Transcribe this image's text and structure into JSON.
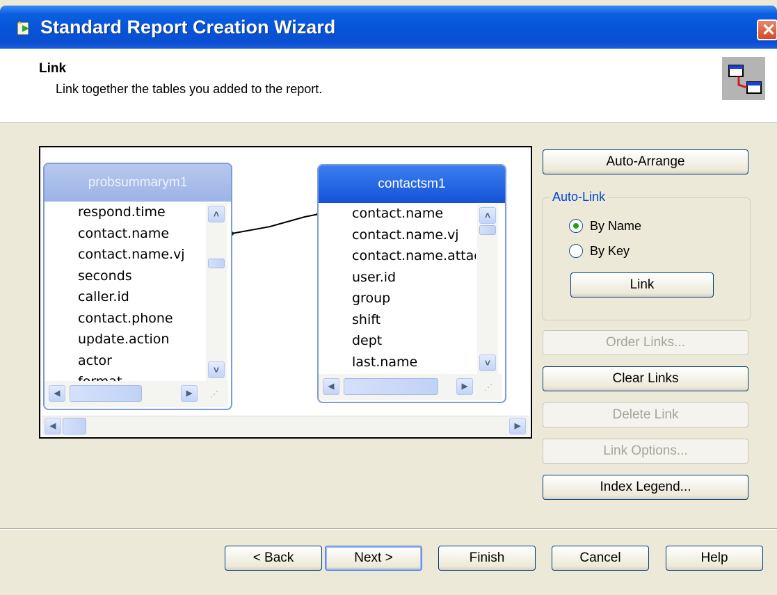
{
  "window": {
    "title": "Standard Report Creation Wizard",
    "close_glyph": "✕"
  },
  "header": {
    "title": "Link",
    "subtitle": "Link together the tables you added to the report."
  },
  "tables": {
    "left": {
      "name": "probsummarym1",
      "fields": [
        "respond.time",
        "contact.name",
        "contact.name.vj",
        "seconds",
        "caller.id",
        "contact.phone",
        "update.action",
        "actor",
        "format"
      ]
    },
    "right": {
      "name": "contactsm1",
      "fields": [
        "contact.name",
        "contact.name.vj",
        "contact.name.attac",
        "user.id",
        "group",
        "shift",
        "dept",
        "last.name"
      ]
    }
  },
  "buttons": {
    "auto_arrange": "Auto-Arrange",
    "auto_link_group": "Auto-Link",
    "by_name": "By Name",
    "by_key": "By Key",
    "link": "Link",
    "order_links": "Order Links...",
    "clear_links": "Clear Links",
    "delete_link": "Delete Link",
    "link_options": "Link Options...",
    "index_legend": "Index Legend..."
  },
  "footer": {
    "back": "< Back",
    "next": "Next >",
    "finish": "Finish",
    "cancel": "Cancel",
    "help": "Help"
  },
  "scroll_glyphs": {
    "up": "˄",
    "down": "˅",
    "left": "◀",
    "right": "▶",
    "grip": "⋰"
  },
  "colors": {
    "title_bar": "#0654d8",
    "active_table_header": "#1452d8",
    "group_label": "#0046d5",
    "radio_selected": "#21a121"
  }
}
